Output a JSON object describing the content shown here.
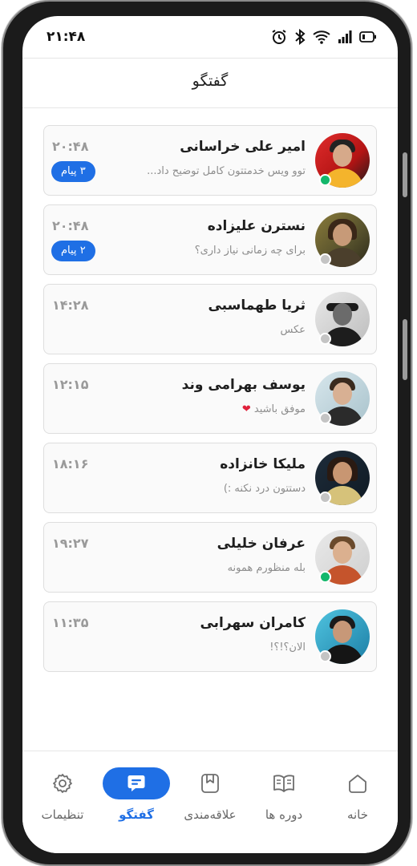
{
  "status_bar": {
    "time": "۲۱:۴۸"
  },
  "header": {
    "title": "گفتگو"
  },
  "colors": {
    "accent": "#1f6fe5",
    "online": "#13b76b",
    "offline": "#c4c4c4"
  },
  "chats": [
    {
      "name": "امیر علی خراسانی",
      "message": "توو ویس خدمتتون کامل توضیح داد...",
      "time": "۲۰:۴۸",
      "badge": "۳ پیام",
      "online": true
    },
    {
      "name": "نسترن علیزاده",
      "message": "برای چه زمانی نیاز داری؟",
      "time": "۲۰:۴۸",
      "badge": "۲ پیام",
      "online": false
    },
    {
      "name": "ثریا طهماسبی",
      "message": "عکس",
      "time": "۱۴:۲۸",
      "badge": "",
      "online": false
    },
    {
      "name": "یوسف بهرامی وند",
      "message": "موفق باشید",
      "message_emoji": "❤",
      "time": "۱۲:۱۵",
      "badge": "",
      "online": false
    },
    {
      "name": "ملیکا خانزاده",
      "message": "دستتون درد نکنه :)",
      "time": "۱۸:۱۶",
      "badge": "",
      "online": false
    },
    {
      "name": "عرفان خلیلی",
      "message": "بله منظورم همونه",
      "time": "۱۹:۲۷",
      "badge": "",
      "online": true
    },
    {
      "name": "کامران سهرابی",
      "message": "الان؟!؟!",
      "time": "۱۱:۳۵",
      "badge": "",
      "online": false
    }
  ],
  "nav": {
    "settings": "تنظیمات",
    "chat": "گفتگو",
    "favorites": "علاقه‌مندی",
    "courses": "دوره ها",
    "home": "خانه"
  }
}
